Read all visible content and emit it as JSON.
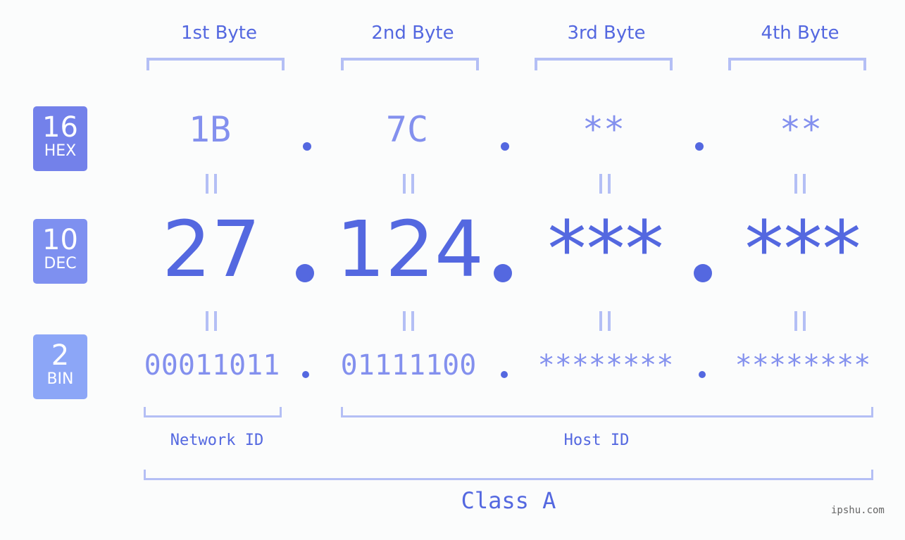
{
  "headers": [
    "1st Byte",
    "2nd Byte",
    "3rd Byte",
    "4th Byte"
  ],
  "badges": {
    "hex": {
      "num": "16",
      "label": "HEX",
      "color": "#7381ea"
    },
    "dec": {
      "num": "10",
      "label": "DEC",
      "color": "#7e90f0"
    },
    "bin": {
      "num": "2",
      "label": "BIN",
      "color": "#8ca6f7"
    }
  },
  "hex_values": [
    "1B",
    "7C",
    "**",
    "**"
  ],
  "dec_values": [
    "27",
    "124",
    "***",
    "***"
  ],
  "bin_values": [
    "00011011",
    "01111100",
    "********",
    "********"
  ],
  "labels": {
    "network_id": "Network ID",
    "host_id": "Host ID",
    "class": "Class A"
  },
  "watermark": "ipshu.com",
  "colors": {
    "accent": "#5468e0",
    "light": "#8390ee",
    "bracket": "#b4bff5"
  }
}
